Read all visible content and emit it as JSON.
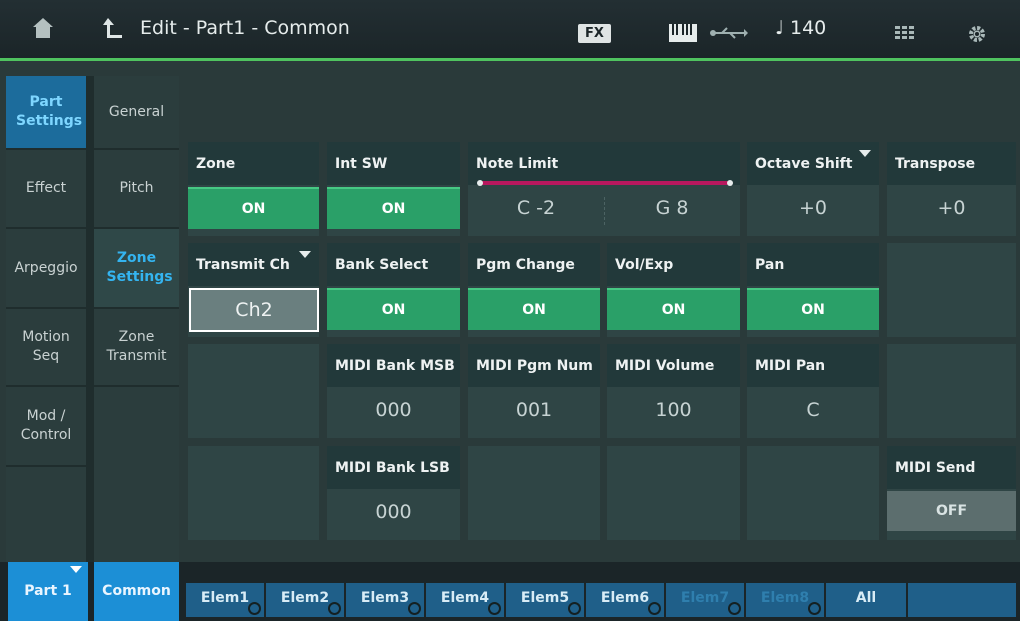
{
  "header": {
    "title": "Edit - Part1 - Common",
    "fx_label": "FX",
    "tempo": "♩ 140",
    "icons": [
      "home-icon",
      "back-arrow-icon",
      "keyboard-icon",
      "usb-icon",
      "grid-icon",
      "gear-icon"
    ]
  },
  "left_menu": {
    "col1": [
      "Part Settings",
      "Effect",
      "Arpeggio",
      "Motion Seq",
      "Mod / Control"
    ],
    "col2": [
      "General",
      "Pitch",
      "Zone Settings",
      "Zone Transmit"
    ]
  },
  "row1": {
    "zone": {
      "label": "Zone",
      "value": "ON"
    },
    "int_sw": {
      "label": "Int SW",
      "value": "ON"
    },
    "note_limit": {
      "label": "Note Limit",
      "low": "C -2",
      "high": "G 8"
    },
    "octave_shift": {
      "label": "Octave Shift",
      "value": "+0"
    },
    "transpose": {
      "label": "Transpose",
      "value": "+0"
    }
  },
  "row2": {
    "transmit_ch": {
      "label": "Transmit Ch",
      "value": "Ch2"
    },
    "bank_select": {
      "label": "Bank Select",
      "value": "ON"
    },
    "pgm_change": {
      "label": "Pgm Change",
      "value": "ON"
    },
    "vol_exp": {
      "label": "Vol/Exp",
      "value": "ON"
    },
    "pan": {
      "label": "Pan",
      "value": "ON"
    }
  },
  "row3": {
    "midi_bank_msb": {
      "label": "MIDI Bank MSB",
      "value": "000"
    },
    "midi_pgm_num": {
      "label": "MIDI Pgm Num",
      "value": "001"
    },
    "midi_volume": {
      "label": "MIDI Volume",
      "value": "100"
    },
    "midi_pan": {
      "label": "MIDI Pan",
      "value": "C"
    }
  },
  "row4": {
    "midi_bank_lsb": {
      "label": "MIDI Bank LSB",
      "value": "000"
    },
    "midi_send": {
      "label": "MIDI Send",
      "value": "OFF"
    }
  },
  "bottom": {
    "part": "Part 1",
    "common": "Common",
    "elements": [
      "Elem1",
      "Elem2",
      "Elem3",
      "Elem4",
      "Elem5",
      "Elem6",
      "Elem7",
      "Elem8",
      "All"
    ]
  },
  "colors": {
    "accent_green": "#2aa068",
    "accent_blue": "#1c8fd6",
    "header_line": "#4fc35f"
  }
}
